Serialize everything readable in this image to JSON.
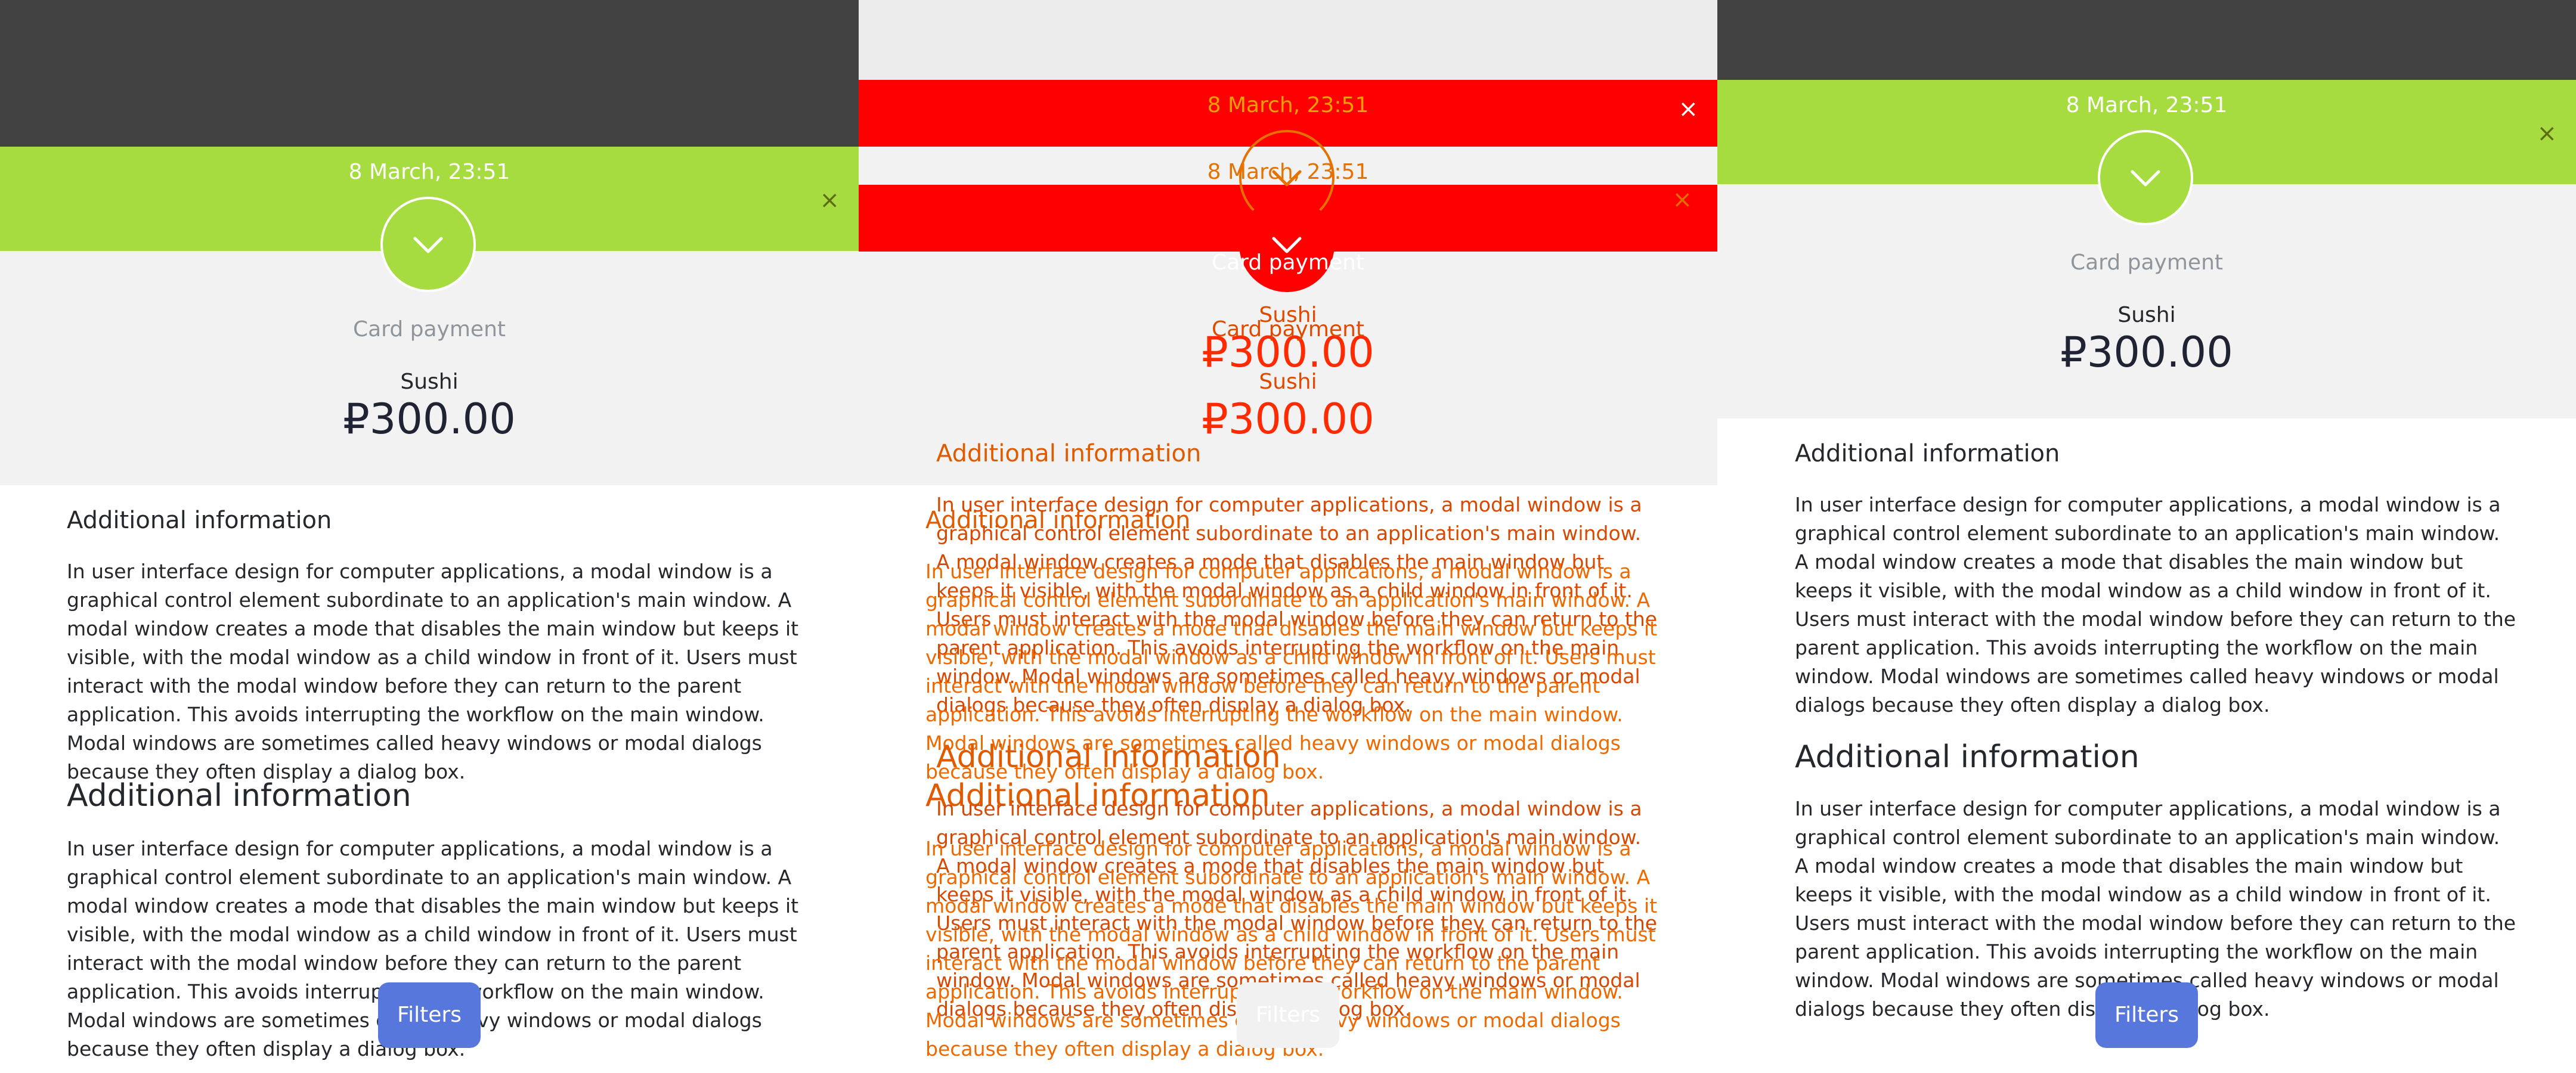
{
  "panels": [
    {
      "label": "before",
      "date": "8 March, 23:51",
      "close_glyph": "×",
      "icon": "chevron-down-icon",
      "payment_method": "Card payment",
      "merchant": "Sushi",
      "amount": "₽300.00",
      "section1_title": "Additional information",
      "section1_text": "In user interface design for computer applications, a modal window is a graphical control element subordinate to an application's main window. A modal window creates a mode that disables the main window but keeps it visible, with the modal window as a child window in front of it. Users must interact with the modal window before they can return to the parent application. This avoids interrupting the workflow on the main window. Modal windows are sometimes called heavy windows or modal dialogs because they often display a dialog box.",
      "section2_title": "Additional information",
      "section2_text": "In user interface design for computer applications, a modal window is a graphical control element subordinate to an application's main window. A modal window creates a mode that disables the main window but keeps it visible, with the modal window as a child window in front of it. Users must interact with the modal window before they can return to the parent application. This avoids interrupting the workflow on the main window. Modal windows are sometimes called heavy windows or modal dialogs because they often display a dialog box.",
      "filters_label": "Filters"
    },
    {
      "label": "diff",
      "date": "8 March, 23:51",
      "close_glyph": "×",
      "icon": "chevron-down-icon",
      "payment_method": "Card payment",
      "merchant": "Sushi",
      "amount": "₽300.00",
      "section1_title": "Additional information",
      "section1_text": "In user interface design for computer applications, a modal window is a graphical control element subordinate to an application's main window. A modal window creates a mode that disables the main window but keeps it visible, with the modal window as a child window in front of it. Users must interact with the modal window before they can return to the parent application. This avoids interrupting the workflow on the main window. Modal windows are sometimes called heavy windows or modal dialogs because they often display a dialog box.",
      "section2_title": "Additional information",
      "section2_text": "In user interface design for computer applications, a modal window is a graphical control element subordinate to an application's main window. A modal window creates a mode that disables the main window but keeps it visible, with the modal window as a child window in front of it. Users must interact with the modal window before they can return to the parent application. This avoids interrupting the workflow on the main window. Modal windows are sometimes called heavy windows or modal dialogs because they often display a dialog box.",
      "filters_label": "Filters"
    },
    {
      "label": "after",
      "date": "8 March, 23:51",
      "close_glyph": "×",
      "icon": "chevron-down-icon",
      "payment_method": "Card payment",
      "merchant": "Sushi",
      "amount": "₽300.00",
      "section1_title": "Additional information",
      "section1_text": "In user interface design for computer applications, a modal window is a graphical control element subordinate to an application's main window. A modal window creates a mode that disables the main window but keeps it visible, with the modal window as a child window in front of it. Users must interact with the modal window before they can return to the parent application. This avoids interrupting the workflow on the main window. Modal windows are sometimes called heavy windows or modal dialogs because they often display a dialog box.",
      "section2_title": "Additional information",
      "section2_text": "In user interface design for computer applications, a modal window is a graphical control element subordinate to an application's main window. A modal window creates a mode that disables the main window but keeps it visible, with the modal window as a child window in front of it. Users must interact with the modal window before they can return to the parent application. This avoids interrupting the workflow on the main window. Modal windows are sometimes called heavy windows or modal dialogs because they often display a dialog box.",
      "filters_label": "Filters"
    }
  ],
  "colors": {
    "overlay_dim": "#424242",
    "success_green": "#a6dc3f",
    "sheet_bg": "#f2f2f2",
    "diff_red": "#ff0000",
    "diff_orange": "#e05a00",
    "filters_blue": "#5877dc"
  }
}
